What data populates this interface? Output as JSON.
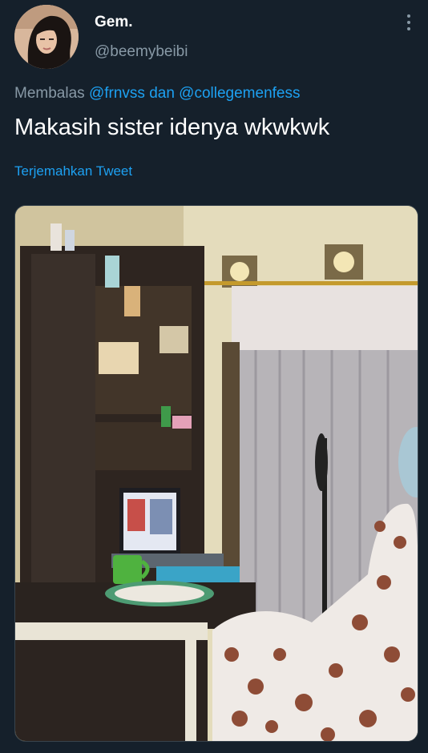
{
  "tweet": {
    "author_name": "Gem.",
    "author_handle": "@beemybeibi",
    "reply_prefix": "Membalas",
    "reply_mention_1": "@frnvss",
    "reply_joiner": "dan",
    "reply_mention_2": "@collegemenfess",
    "text": "Makasih sister idenya wkwkwk",
    "translate_label": "Terjemahkan Tweet"
  },
  "colors": {
    "background": "#15202b",
    "primary_text": "#ffffff",
    "secondary_text": "#8899a6",
    "link": "#1da1f2"
  },
  "icons": {
    "more": "more-vertical-icon"
  }
}
